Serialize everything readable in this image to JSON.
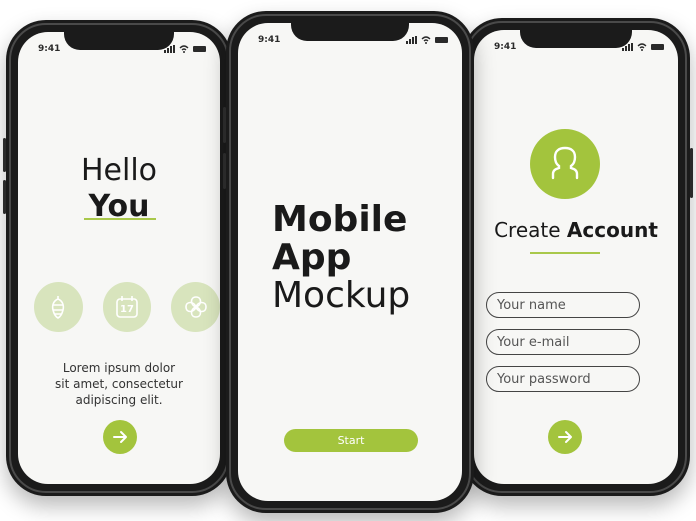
{
  "status_time": "9:41",
  "colors": {
    "accent": "#a3c43d",
    "accent_light": "#d8e4bd",
    "frame": "#1b1b1b",
    "screen": "#f7f7f5"
  },
  "left_screen": {
    "title_light": "Hello",
    "title_bold": "You",
    "icons": [
      "hop-cone-icon",
      "calendar-icon",
      "celtic-knot-icon"
    ],
    "calendar_day": "17",
    "body_lines": [
      "Lorem ipsum dolor",
      "sit amet, consectetur",
      "adipiscing elit."
    ],
    "next_icon": "arrow-right-icon"
  },
  "center_screen": {
    "title_lines": [
      "Mobile",
      "App",
      "Mockup"
    ],
    "start_label": "Start"
  },
  "right_screen": {
    "avatar_icon": "user-icon",
    "title_light": "Create",
    "title_bold": "Account",
    "fields": [
      {
        "placeholder": "Your name"
      },
      {
        "placeholder": "Your e-mail"
      },
      {
        "placeholder": "Your password"
      }
    ],
    "next_icon": "arrow-right-icon"
  }
}
